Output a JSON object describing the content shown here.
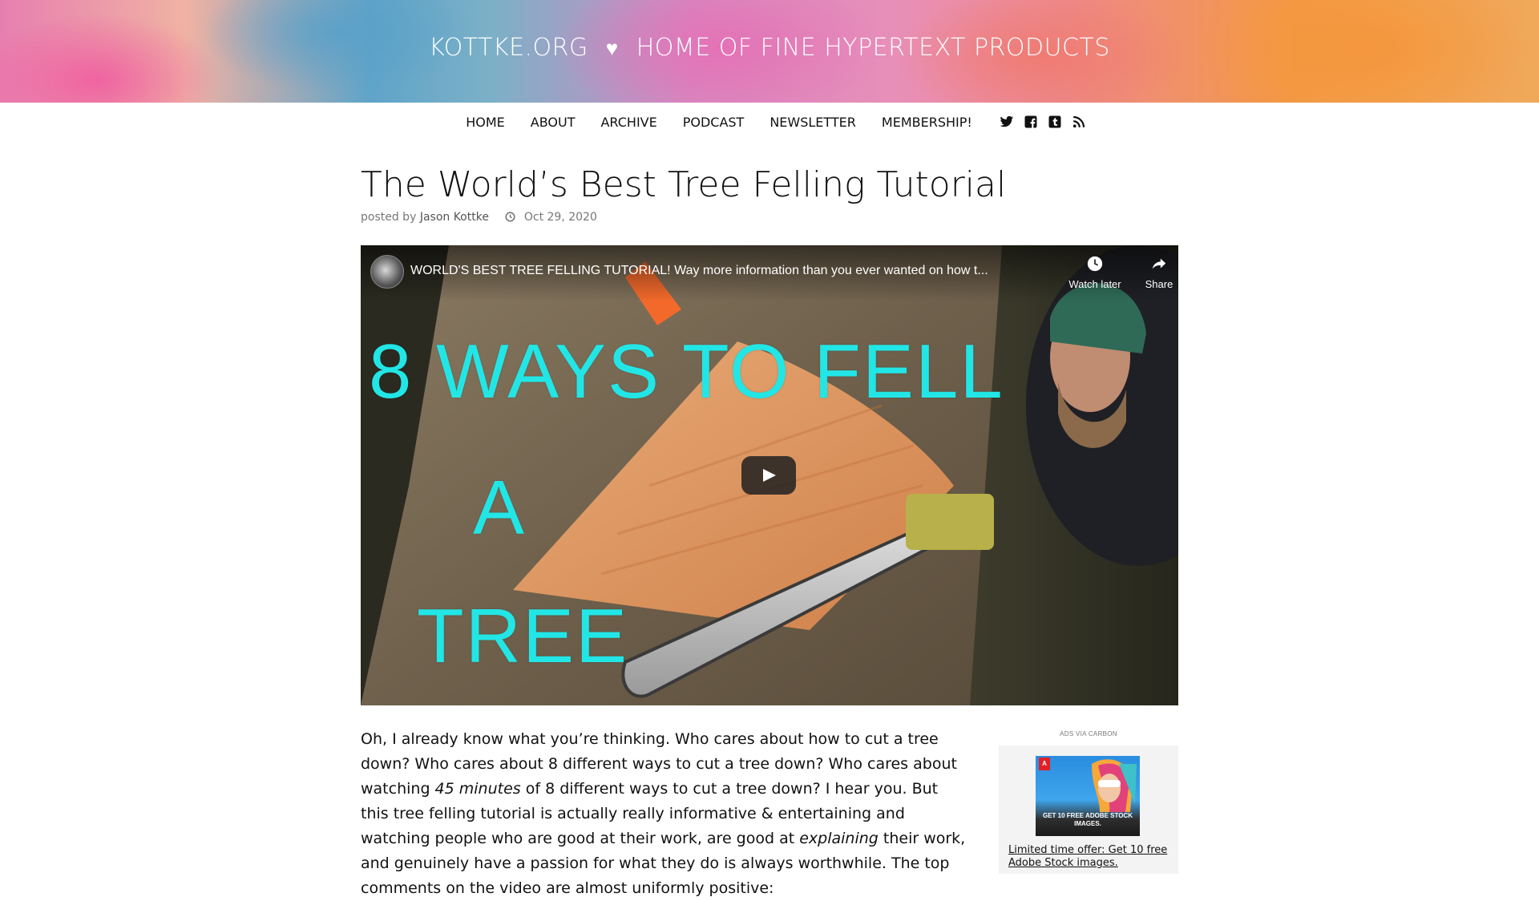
{
  "banner": {
    "site": "KOTTKE.ORG",
    "separator": "♥",
    "tagline": "HOME OF FINE HYPERTEXT PRODUCTS"
  },
  "nav": {
    "items": [
      "HOME",
      "ABOUT",
      "ARCHIVE",
      "PODCAST",
      "NEWSLETTER",
      "MEMBERSHIP!"
    ],
    "icons": [
      "twitter-icon",
      "facebook-icon",
      "tumblr-icon",
      "rss-icon"
    ]
  },
  "post": {
    "title": "The World’s Best Tree Felling Tutorial",
    "posted_by_prefix": "posted by",
    "author": "Jason Kottke",
    "date": "Oct 29, 2020"
  },
  "video": {
    "title": "WORLD'S BEST TREE FELLING TUTORIAL! Way more information than you ever wanted on how t...",
    "watch_later": "Watch later",
    "share": "Share",
    "thumbnail_text": {
      "line1": "8 WAYS TO FELL",
      "line2": "A",
      "line3": "TREE"
    },
    "thumbnail_text_color": "#22e6e6"
  },
  "article": {
    "p1_a": "Oh, I already know what you’re thinking. Who cares about how to cut a tree down? Who cares about 8 different ways to cut a tree down? Who cares about watching ",
    "p1_em1": "45 minutes",
    "p1_b": " of 8 different ways to cut a tree down? I hear you. But this tree felling tutorial is actually really informative & entertaining and watching people who are good at their work, are good at ",
    "p1_em2": "explaining",
    "p1_c": " their work, and genuinely have a passion for what they do is always worthwhile. The top comments on the video are almost uniformly positive:"
  },
  "ad": {
    "label": "ADS VIA CARBON",
    "image_text": "GET 10 FREE ADOBE STOCK IMAGES.",
    "logo_text": "A",
    "link_text": "Limited time offer: Get 10 free Adobe Stock images."
  }
}
